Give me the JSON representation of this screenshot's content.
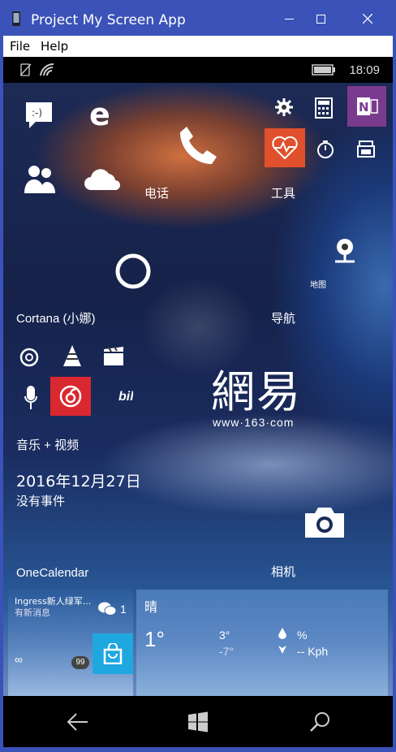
{
  "window": {
    "title": "Project My Screen App"
  },
  "menubar": {
    "file": "File",
    "help": "Help"
  },
  "status": {
    "time": "18:09"
  },
  "tiles": {
    "phone_label": "电话",
    "tools_label": "工具",
    "cortana_label": "Cortana (小娜)",
    "nav_label": "导航",
    "map_small": "地图",
    "music_label": "音乐 + 视频",
    "netease_brand": "網易",
    "netease_url": "www·163·com",
    "calendar_date": "2016年12月27日",
    "calendar_events": "没有事件",
    "calendar_label": "OneCalendar",
    "camera_label": "相机",
    "ingress_title": "Ingress新人绿军...",
    "ingress_sub": "有新消息",
    "wechat_count": "1",
    "badge_99": "99",
    "infinity": "∞",
    "weather_condition": "晴",
    "weather_temp": "1°",
    "weather_high": "3°",
    "weather_low": "-7°",
    "weather_humidity": "%",
    "weather_wind": "-- Kph",
    "bili": "bili"
  },
  "colors": {
    "accent_red": "#d9282f",
    "onenote": "#7a3b8f",
    "store": "#1fa8e0",
    "health": "#e0502c"
  }
}
